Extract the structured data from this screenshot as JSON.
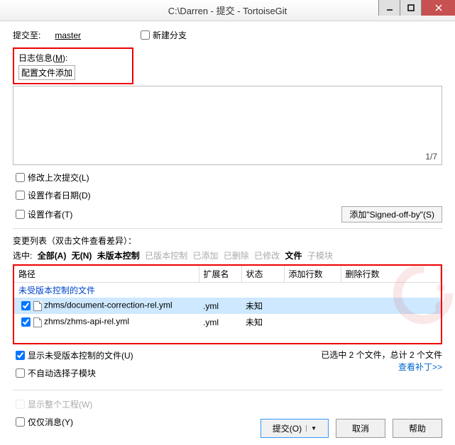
{
  "window": {
    "title": "C:\\Darren - 提交 - TortoiseGit"
  },
  "commit_to": {
    "label": "提交至:",
    "branch": "master"
  },
  "new_branch": {
    "label": "新建分支"
  },
  "log": {
    "label_pre": "日志信息(",
    "label_key": "M",
    "label_post": "):",
    "message": "配置文件添加",
    "counter": "1/7"
  },
  "options": {
    "amend": "修改上次提交(L)",
    "set_date": "设置作者日期(D)",
    "set_author": "设置作者(T)",
    "signed_off": "添加\"Signed-off-by\"(S)"
  },
  "changelist": {
    "header": "变更列表（双击文件查看差异）：",
    "filters": {
      "label": "选中:",
      "all": "全部(A)",
      "none": "无(N)",
      "unversioned": "未版本控制",
      "versioned": "已版本控制",
      "added": "已添加",
      "deleted": "已删除",
      "modified": "已修改",
      "files": "文件",
      "submodules": "子模块"
    },
    "columns": {
      "path": "路径",
      "ext": "扩展名",
      "status": "状态",
      "add_lines": "添加行数",
      "del_lines": "删除行数"
    },
    "unversioned_header": "未受版本控制的文件",
    "files": [
      {
        "checked": true,
        "path": "zhms/document-correction-rel.yml",
        "ext": ".yml",
        "status": "未知"
      },
      {
        "checked": true,
        "path": "zhms/zhms-api-rel.yml",
        "ext": ".yml",
        "status": "未知"
      }
    ]
  },
  "summary": {
    "show_unversioned": "显示未受版本控制的文件(U)",
    "no_auto_submodule": "不自动选择子模块",
    "selected_text": "已选中 2 个文件，总计 2 个文件",
    "patch_link": "查看补丁>>"
  },
  "bottom": {
    "show_whole_project": "显示整个工程(W)",
    "message_only": "仅仅消息(Y)"
  },
  "buttons": {
    "commit": "提交(O)",
    "cancel": "取消",
    "help": "帮助"
  }
}
